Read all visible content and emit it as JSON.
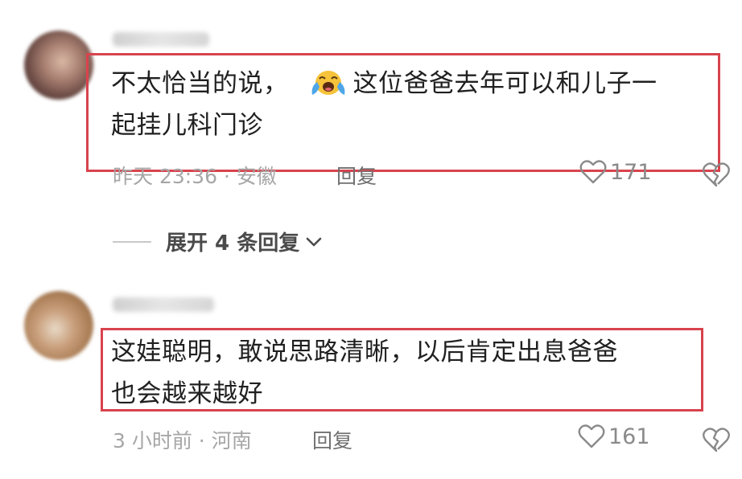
{
  "comments": [
    {
      "text_before_emoji": "不太恰当的说，",
      "emoji": "loudly-crying-face-emoji",
      "text_after_emoji_line1": "这位爸爸去年可以和儿子一",
      "text_line2": "起挂儿科门诊",
      "meta": "昨天 23:36 · 安徽",
      "reply_label": "回复",
      "likes": "171"
    },
    {
      "text_line1": "这娃聪明，敢说思路清晰，以后肯定出息爸爸",
      "text_line2": "也会越来越好",
      "meta": "3 小时前 · 河南",
      "reply_label": "回复",
      "likes": "161"
    }
  ],
  "expand_replies": {
    "label": "展开 4 条回复"
  },
  "colors": {
    "highlight_border": "#d8434d",
    "text_primary": "#202020",
    "text_meta": "#a6a6a6",
    "icon_gray": "#8a8a8a"
  }
}
